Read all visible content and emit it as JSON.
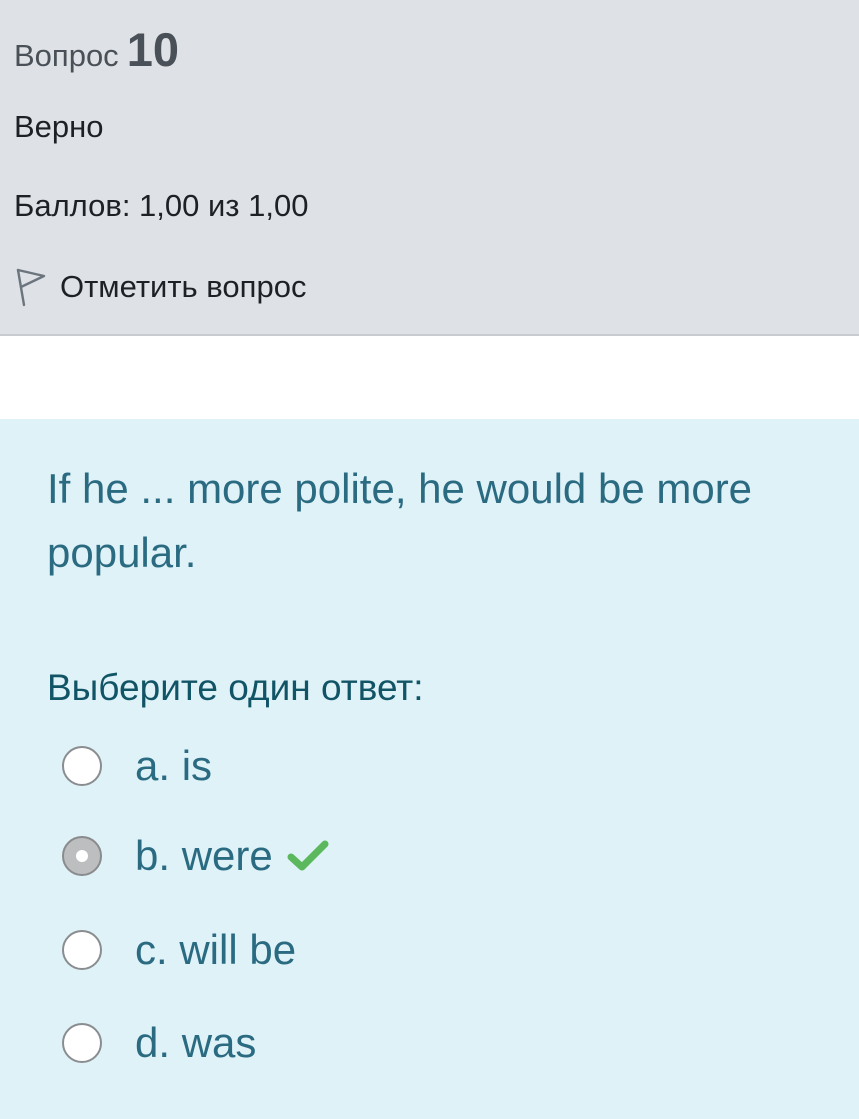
{
  "question": {
    "label": "Вопрос",
    "number": "10",
    "state": "Верно",
    "grade": "Баллов: 1,00 из 1,00",
    "flag_label": "Отметить вопрос",
    "flag_icon": "flag-icon",
    "text": "If he ... more polite, he would be more popular.",
    "prompt": "Выберите один ответ:",
    "options": [
      {
        "label": "a. is",
        "checked": false
      },
      {
        "label": "b. were",
        "checked": true,
        "correct_icon": "check-icon"
      },
      {
        "label": "c. will be",
        "checked": false
      },
      {
        "label": "d. was",
        "checked": false
      }
    ]
  },
  "colors": {
    "info_background": "#dee2e6",
    "content_background": "#def2f8",
    "question_text": "#2b6b82",
    "correct_check": "#5cb85c"
  }
}
